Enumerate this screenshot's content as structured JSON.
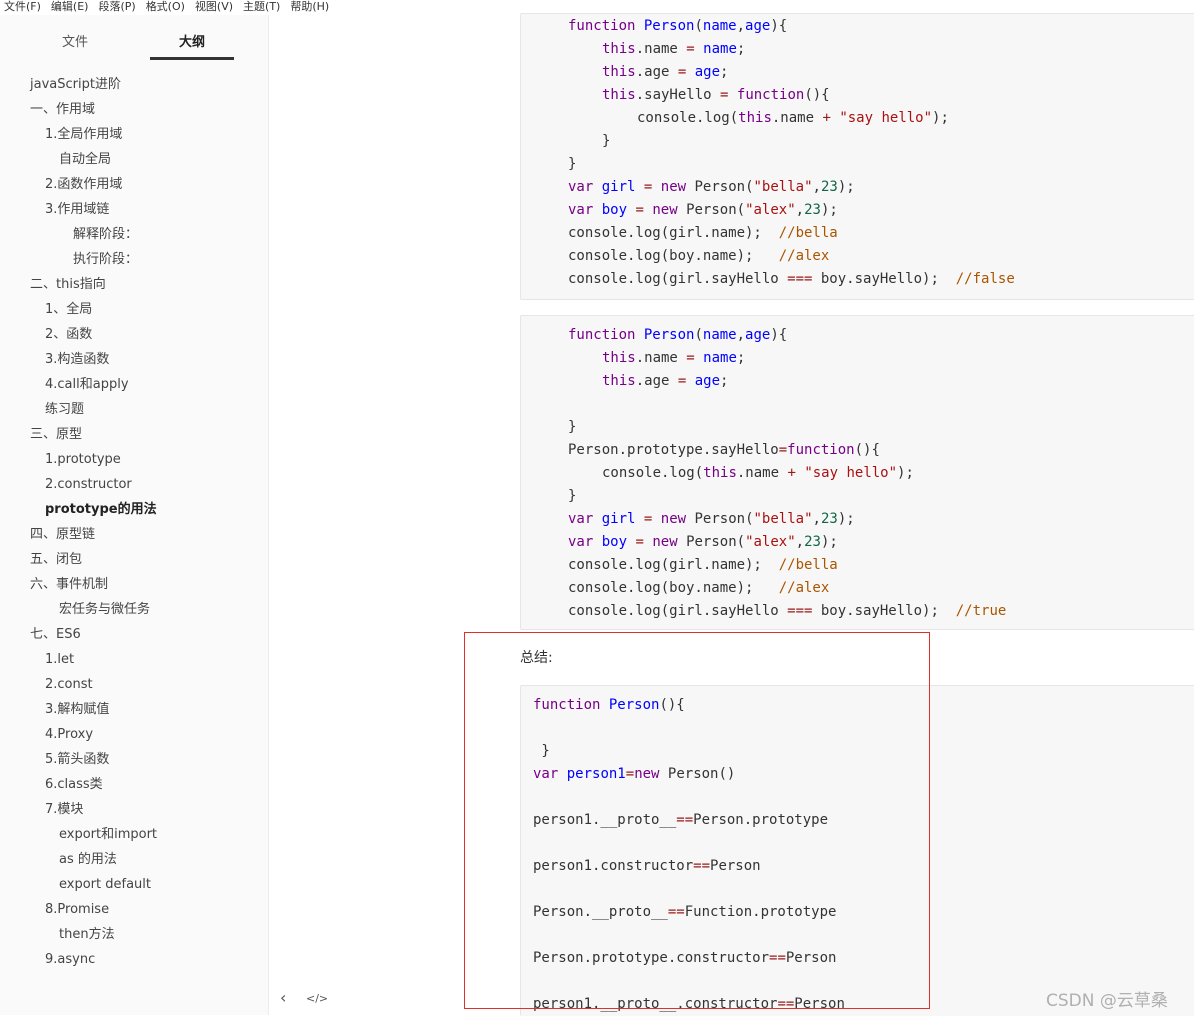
{
  "menubar": {
    "items": [
      "文件(F)",
      "编辑(E)",
      "段落(P)",
      "格式(O)",
      "视图(V)",
      "主题(T)",
      "帮助(H)"
    ]
  },
  "sidebar": {
    "tabs": {
      "files": "文件",
      "outline": "大纲",
      "active": "outline"
    },
    "outline": [
      {
        "label": "javaScript进阶"
      },
      {
        "label": "一、作用域"
      },
      {
        "label": "1.全局作用域"
      },
      {
        "label": "自动全局"
      },
      {
        "label": "2.函数作用域"
      },
      {
        "label": "3.作用域链"
      },
      {
        "label": "解释阶段："
      },
      {
        "label": "执行阶段："
      },
      {
        "label": "二、this指向"
      },
      {
        "label": "1、全局"
      },
      {
        "label": "2、函数"
      },
      {
        "label": "3.构造函数"
      },
      {
        "label": "4.call和apply"
      },
      {
        "label": "练习题"
      },
      {
        "label": "三、原型"
      },
      {
        "label": "1.prototype"
      },
      {
        "label": "2.constructor"
      },
      {
        "label": "prototype的用法"
      },
      {
        "label": "四、原型链"
      },
      {
        "label": "五、闭包"
      },
      {
        "label": "六、事件机制"
      },
      {
        "label": "宏任务与微任务"
      },
      {
        "label": "七、ES6"
      },
      {
        "label": "1.let"
      },
      {
        "label": "2.const"
      },
      {
        "label": "3.解构赋值"
      },
      {
        "label": "4.Proxy"
      },
      {
        "label": "5.箭头函数"
      },
      {
        "label": "6.class类"
      },
      {
        "label": "7.模块"
      },
      {
        "label": "export和import"
      },
      {
        "label": "as 的用法"
      },
      {
        "label": "export default"
      },
      {
        "label": "8.Promise"
      },
      {
        "label": "then方法"
      },
      {
        "label": "9.async"
      }
    ]
  },
  "bottom": {
    "back_icon": "chevron-left-icon",
    "source_icon": "code-icon",
    "back_glyph": "‹",
    "source_glyph": "</>"
  },
  "content": {
    "summary_label": "总结:",
    "watermark": "CSDN @云草桑",
    "accent_red": "#e0302a"
  }
}
